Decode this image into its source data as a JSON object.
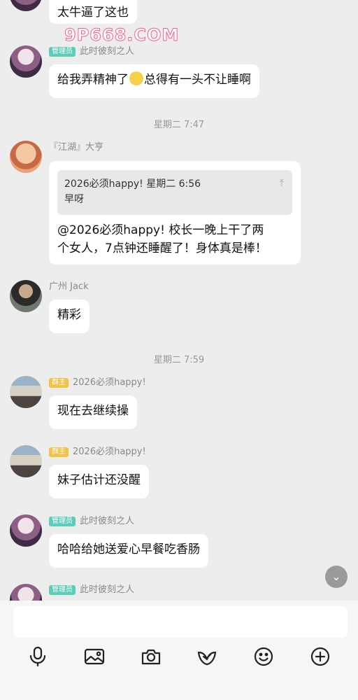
{
  "watermark": "9P668.COM",
  "messages": [
    {
      "text": "太牛逼了这也"
    },
    {
      "sender": "此时彼刻之人",
      "badge": "管理员",
      "text_before": "给我弄精神了",
      "text_after": "总得有一头不让睡啊"
    },
    {
      "time": "星期二 7:47"
    },
    {
      "sender": "『江湖』大亨",
      "quote": {
        "title": "2026必须happy! 星期二 6:56",
        "text": "早呀"
      },
      "text_line1": "@2026必须happy! 校长一晚上干了两",
      "text_line2": "个女人，7点钟还睡醒了！身体真是棒！"
    },
    {
      "sender": "广州 Jack",
      "text": "精彩"
    },
    {
      "time": "星期二 7:59"
    },
    {
      "sender": "2026必须happy!",
      "badge": "群主",
      "text": "现在去继续操"
    },
    {
      "sender": "2026必须happy!",
      "badge": "群主",
      "text": "妹子估计还没醒"
    },
    {
      "sender": "此时彼刻之人",
      "badge": "管理员",
      "text": "哈哈给她送爱心早餐吃香肠"
    },
    {
      "sender": "此时彼刻之人",
      "badge": "管理员"
    }
  ],
  "toolbar": [
    "microphone-icon",
    "image-icon",
    "camera-icon",
    "red-packet-icon",
    "emoji-icon",
    "plus-icon"
  ]
}
